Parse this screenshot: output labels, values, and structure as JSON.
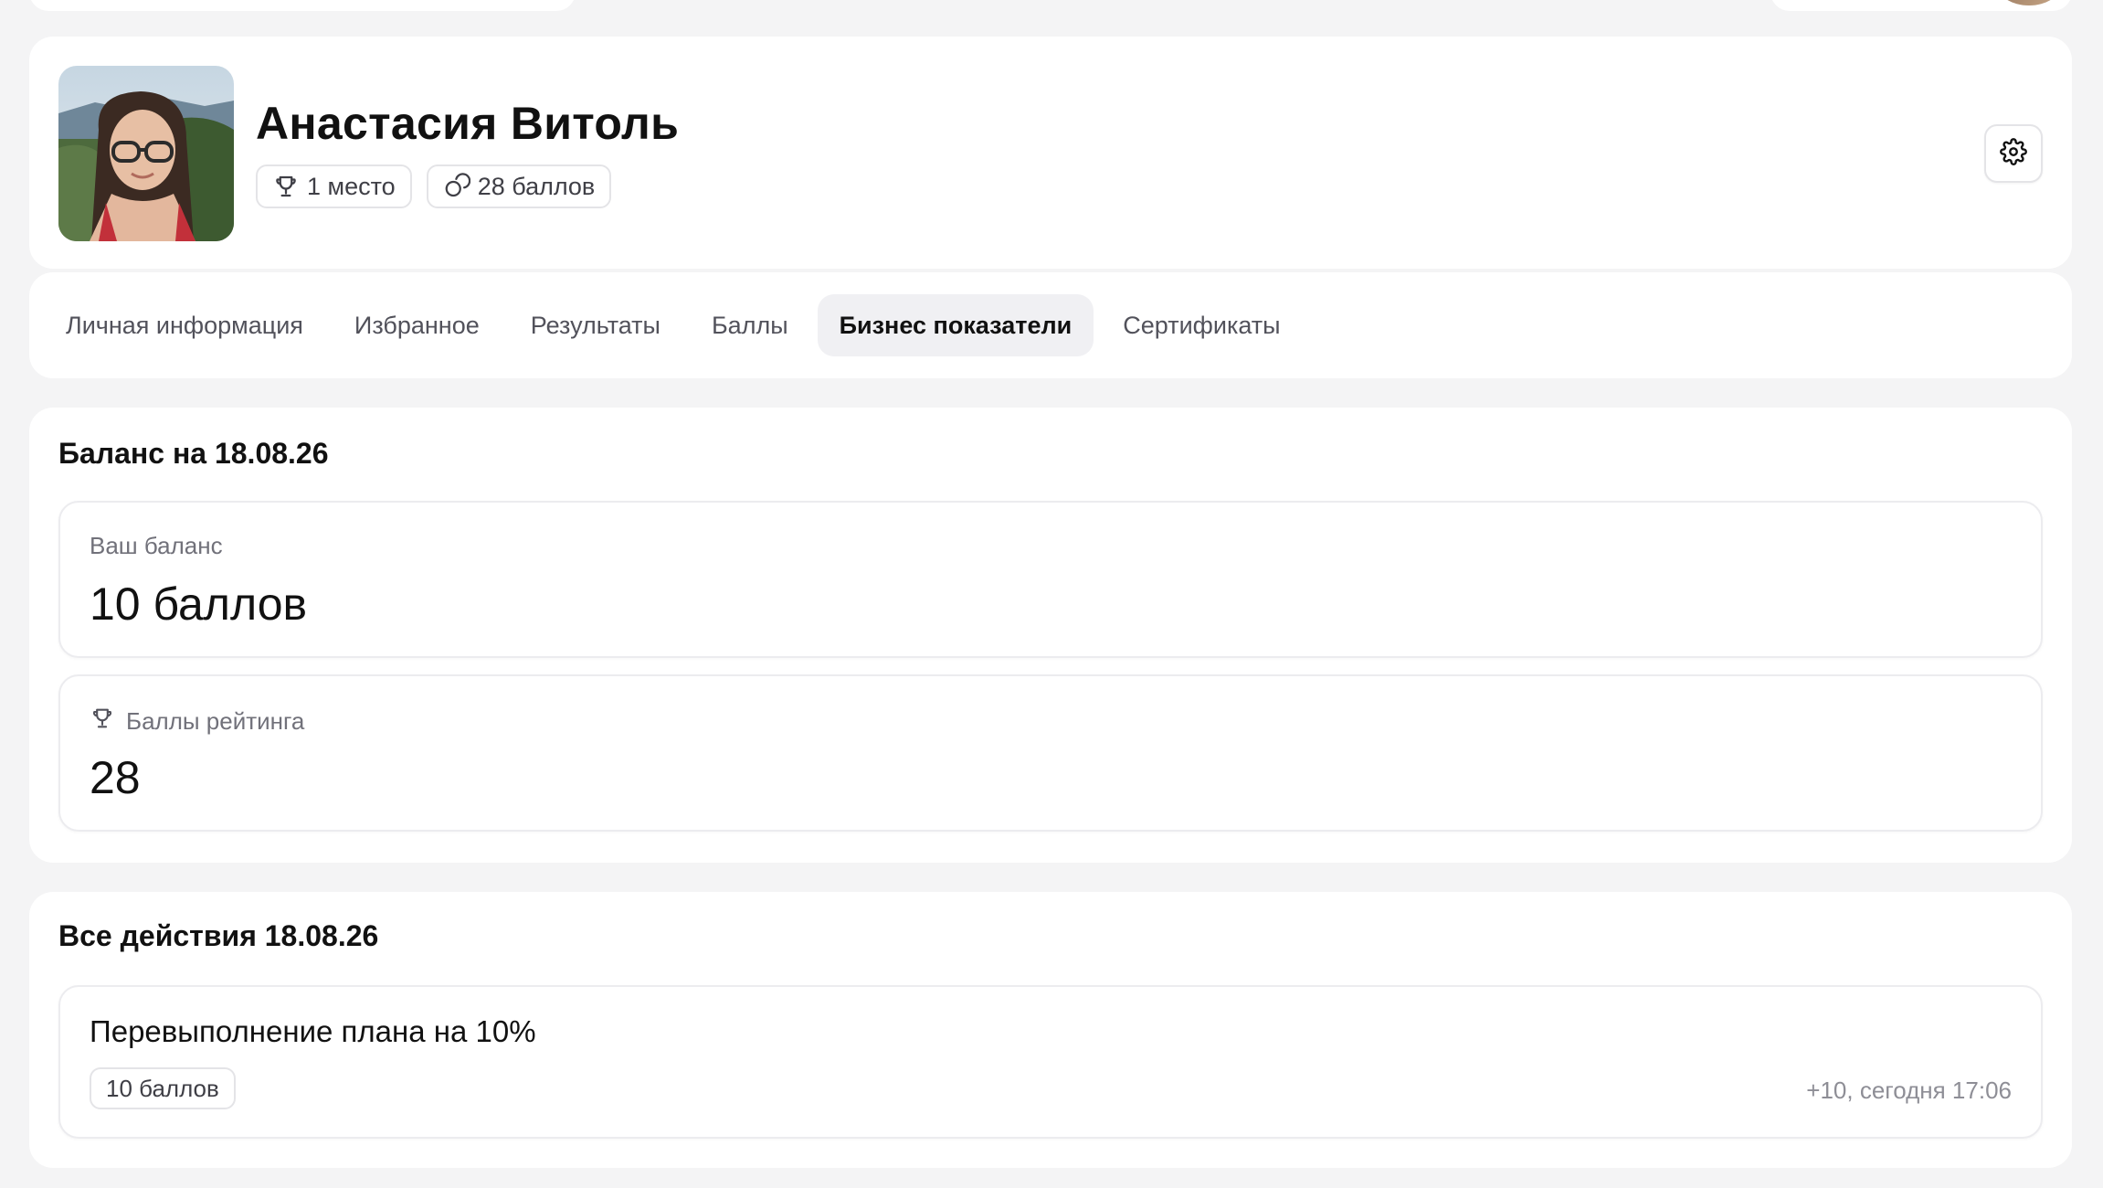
{
  "profile": {
    "name": "Анастасия Витоль",
    "place": "1 место",
    "points": "28 баллов"
  },
  "tabs": [
    {
      "label": "Личная информация",
      "active": false
    },
    {
      "label": "Избранное",
      "active": false
    },
    {
      "label": "Результаты",
      "active": false
    },
    {
      "label": "Баллы",
      "active": false
    },
    {
      "label": "Бизнес показатели",
      "active": true
    },
    {
      "label": "Сертификаты",
      "active": false
    }
  ],
  "balance": {
    "title": "Баланс на 18.08.26",
    "your_balance_label": "Ваш баланс",
    "your_balance_value": "10 баллов",
    "rating_label": "Баллы рейтинга",
    "rating_value": "28"
  },
  "actions": {
    "title": "Все действия 18.08.26",
    "items": [
      {
        "title": "Перевыполнение плана на 10%",
        "badge": "10 баллов",
        "meta": "+10, сегодня 17:06"
      }
    ]
  },
  "icons": {
    "place": "trophy-icon",
    "points": "coins-icon",
    "settings": "gear-icon",
    "rating": "trophy-icon"
  },
  "colors": {
    "page_bg": "#f4f4f5",
    "card_bg": "#ffffff",
    "active_tab_bg": "#f0f0f3",
    "muted_text": "#71717a",
    "border": "#e4e4e7"
  }
}
